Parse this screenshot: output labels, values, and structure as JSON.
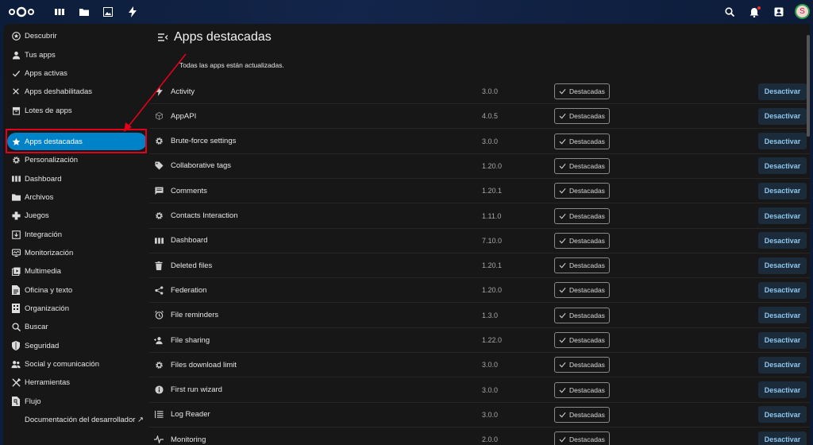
{
  "topbar": {
    "apps": [
      {
        "name": "dashboard-icon"
      },
      {
        "name": "files-icon"
      },
      {
        "name": "photos-icon"
      },
      {
        "name": "activity-icon"
      }
    ],
    "right_icons": [
      "search-icon",
      "notifications-icon",
      "contacts-icon"
    ],
    "avatar_letter": "S"
  },
  "sidebar": {
    "items": [
      {
        "label": "Descubrir",
        "icon": "star-circle-icon"
      },
      {
        "label": "Tus apps",
        "icon": "account-icon"
      },
      {
        "label": "Apps activas",
        "icon": "check-icon"
      },
      {
        "label": "Apps deshabilitadas",
        "icon": "close-icon"
      },
      {
        "label": "Lotes de apps",
        "icon": "archive-icon"
      },
      {
        "label": "Apps destacadas",
        "icon": "star-icon",
        "active": true
      },
      {
        "label": "Personalización",
        "icon": "cog-icon"
      },
      {
        "label": "Dashboard",
        "icon": "dashboard-icon"
      },
      {
        "label": "Archivos",
        "icon": "folder-icon"
      },
      {
        "label": "Juegos",
        "icon": "gamepad-icon"
      },
      {
        "label": "Integración",
        "icon": "integration-icon"
      },
      {
        "label": "Monitorización",
        "icon": "monitor-icon"
      },
      {
        "label": "Multimedia",
        "icon": "multimedia-icon"
      },
      {
        "label": "Oficina y texto",
        "icon": "office-icon"
      },
      {
        "label": "Organización",
        "icon": "organization-icon"
      },
      {
        "label": "Buscar",
        "icon": "search-icon"
      },
      {
        "label": "Seguridad",
        "icon": "shield-icon"
      },
      {
        "label": "Social y comunicación",
        "icon": "social-icon"
      },
      {
        "label": "Herramientas",
        "icon": "tools-icon"
      },
      {
        "label": "Flujo",
        "icon": "flow-icon"
      },
      {
        "label": "Documentación del desarrollador ↗",
        "icon": "none"
      }
    ]
  },
  "main": {
    "title": "Apps destacadas",
    "updated_message": "Todas las apps están actualizadas.",
    "badge_label": "Destacadas",
    "button_label": "Desactivar",
    "apps": [
      {
        "name": "Activity",
        "version": "3.0.0",
        "icon": "activity-icon"
      },
      {
        "name": "AppAPI",
        "version": "4.0.5",
        "icon": "cube-icon"
      },
      {
        "name": "Brute-force settings",
        "version": "3.0.0",
        "icon": "cog-icon"
      },
      {
        "name": "Collaborative tags",
        "version": "1.20.0",
        "icon": "tag-icon"
      },
      {
        "name": "Comments",
        "version": "1.20.1",
        "icon": "comment-icon"
      },
      {
        "name": "Contacts Interaction",
        "version": "1.11.0",
        "icon": "cog-icon"
      },
      {
        "name": "Dashboard",
        "version": "7.10.0",
        "icon": "dashboard-icon"
      },
      {
        "name": "Deleted files",
        "version": "1.20.1",
        "icon": "trash-icon"
      },
      {
        "name": "Federation",
        "version": "1.20.0",
        "icon": "share-icon"
      },
      {
        "name": "File reminders",
        "version": "1.3.0",
        "icon": "alarm-icon"
      },
      {
        "name": "File sharing",
        "version": "1.22.0",
        "icon": "share-user-icon"
      },
      {
        "name": "Files download limit",
        "version": "3.0.0",
        "icon": "cog-icon"
      },
      {
        "name": "First run wizard",
        "version": "3.0.0",
        "icon": "info-icon"
      },
      {
        "name": "Log Reader",
        "version": "3.0.0",
        "icon": "list-icon"
      },
      {
        "name": "Monitoring",
        "version": "2.0.0",
        "icon": "pulse-icon"
      }
    ]
  },
  "colors": {
    "accent": "#0082c9",
    "annotation_red": "#e3001b",
    "panel": "#171717"
  }
}
